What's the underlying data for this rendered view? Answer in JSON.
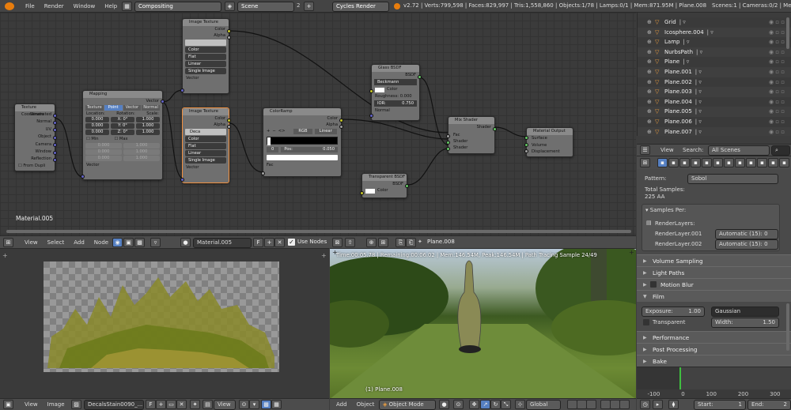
{
  "topbar": {
    "menus": [
      "File",
      "Render",
      "Window",
      "Help"
    ],
    "screen": "Compositing",
    "scene": "Scene",
    "scene_num": "2",
    "engine": "Cycles Render",
    "stats": "v2.72 | Verts:799,598 | Faces:829,997 | Tris:1,558,860 | Objects:1/78 | Lamps:0/1 | Mem:871.95M | Plane.008",
    "stats_right": "Scenes:1 | Cameras:0/2 | Meshe"
  },
  "nodes": {
    "texcoord": {
      "title": "Texture Coordinate",
      "outs": [
        "Generated",
        "Normal",
        "UV",
        "Object",
        "Camera",
        "Window",
        "Reflection"
      ],
      "from_dupli": "From Dupli"
    },
    "mapping": {
      "title": "Mapping",
      "tabs": [
        "Texture",
        "Point",
        "Vector",
        "Normal"
      ],
      "cols": [
        "Location:",
        "Rotation:",
        "Scale:"
      ],
      "rows": [
        [
          "0.000",
          "X: 0°",
          "1.000"
        ],
        [
          "0.000",
          "Y: 0°",
          "1.000"
        ],
        [
          "0.000",
          "Z: 0°",
          "1.000"
        ]
      ],
      "min": "Min",
      "max": "Max",
      "mm": [
        [
          "0.000",
          "1.000"
        ],
        [
          "0.000",
          "1.000"
        ],
        [
          "0.000",
          "1.000"
        ]
      ],
      "vector": "Vector"
    },
    "imgtex1": {
      "title": "Image Texture",
      "color": "Color",
      "alpha": "Alpha",
      "opts": [
        "Color",
        "Flat",
        "Linear",
        "Single Image"
      ],
      "vector": "Vector"
    },
    "imgtex2": {
      "title": "Image Texture",
      "img": "Deca",
      "color": "Color",
      "alpha": "Alpha",
      "opts": [
        "Color",
        "Flat",
        "Linear",
        "Single Image"
      ],
      "vector": "Vector"
    },
    "colorramp": {
      "title": "ColorRamp",
      "color": "Color",
      "alpha": "Alpha",
      "mode": "RGB",
      "interp": "Linear",
      "stop": "0",
      "pos_label": "Pos:",
      "pos": "0.050",
      "fac": "Fac",
      "buttons": [
        "+",
        "−",
        "<>"
      ]
    },
    "glass": {
      "title": "Glass BSDF",
      "bsdf": "BSDF",
      "dist": "Beckmann",
      "color": "Color",
      "rough": "Roughness: 0.000",
      "ior_label": "IOR:",
      "ior": "0.750",
      "normal": "Normal"
    },
    "transparent": {
      "title": "Transparent BSDF",
      "bsdf": "BSDF",
      "color": "Color"
    },
    "mix": {
      "title": "Mix Shader",
      "shader": "Shader",
      "fac": "Fac",
      "in1": "Shader",
      "in2": "Shader"
    },
    "output": {
      "title": "Material Output",
      "surface": "Surface",
      "volume": "Volume",
      "disp": "Displacement"
    }
  },
  "node_editor": {
    "material_label": "Material.005",
    "menus": [
      "View",
      "Select",
      "Add",
      "Node"
    ],
    "material": "Material.005",
    "f": "F",
    "use_nodes": "Use Nodes",
    "object": "Plane.008"
  },
  "image_editor": {
    "menus": [
      "View",
      "Image"
    ],
    "image": "DecalsStain0090_...",
    "f": "F",
    "view": "View"
  },
  "viewport": {
    "info": "Time:00:05.78 | Remaining:00:06.02 | Mem:146.54M, Peak:146.54M | Path Tracing Sample 24/49",
    "object_label": "(1) Plane.008",
    "menus": [
      "Add",
      "Object"
    ],
    "mode": "Object Mode",
    "orientation": "Global"
  },
  "outliner": {
    "items": [
      "Grid",
      "Icosphere.004",
      "Lamp",
      "NurbsPath",
      "Plane",
      "Plane.001",
      "Plane.002",
      "Plane.003",
      "Plane.004",
      "Plane.005",
      "Plane.006",
      "Plane.007"
    ],
    "view": "View",
    "search": "Search:",
    "scenes": "All Scenes"
  },
  "properties": {
    "pattern_label": "Pattern:",
    "pattern": "Sobol",
    "total_samples": "Total Samples:",
    "aa": "225 AA",
    "samples_per": "Samples Per:",
    "renderlayers": "RenderLayers:",
    "rl": [
      {
        "name": "RenderLayer.001",
        "val": "Automatic (15):",
        "n": "0"
      },
      {
        "name": "RenderLayer.002",
        "val": "Automatic (15):",
        "n": "0"
      }
    ],
    "panels": [
      "Volume Sampling",
      "Light Paths",
      "Motion Blur",
      "Film"
    ],
    "exposure_label": "Exposure:",
    "exposure": "1.00",
    "filter": "Gaussian",
    "transparent": "Transparent",
    "width_label": "Width:",
    "width": "1.50",
    "panels2": [
      "Performance",
      "Post Processing",
      "Bake"
    ]
  },
  "timeline": {
    "ticks": [
      "-100",
      "0",
      "100",
      "200",
      "300"
    ],
    "start_label": "Start:",
    "start": "1",
    "end_label": "End:",
    "end": "2"
  },
  "colors": {
    "accent": "#f0a040",
    "socket_yellow": "#c7c729",
    "socket_purple": "#6363c7",
    "socket_green": "#63c763"
  }
}
